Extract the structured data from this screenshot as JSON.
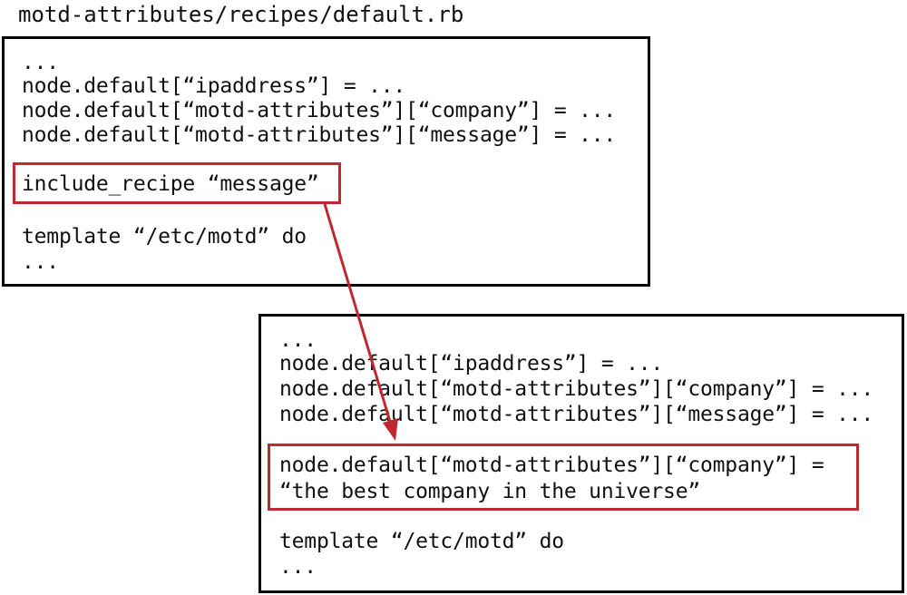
{
  "caption": "motd-attributes/recipes/default.rb",
  "box1": {
    "lines": [
      "...",
      "node.default[“ipaddress”] = ...",
      "node.default[“motd-attributes”][“company”] = ...",
      "node.default[“motd-attributes”][“message”] = ...",
      "include_recipe “message”",
      "template “/etc/motd” do",
      "..."
    ]
  },
  "box2": {
    "lines": [
      "...",
      "node.default[“ipaddress”] = ...",
      "node.default[“motd-attributes”][“company”] = ...",
      "node.default[“motd-attributes”][“message”] = ...",
      "node.default[“motd-attributes”][“company”] =",
      "“the best company in the universe”",
      "template “/etc/motd” do",
      "..."
    ]
  },
  "colors": {
    "highlight": "#c0282f",
    "border": "#000000",
    "text": "#111111"
  }
}
